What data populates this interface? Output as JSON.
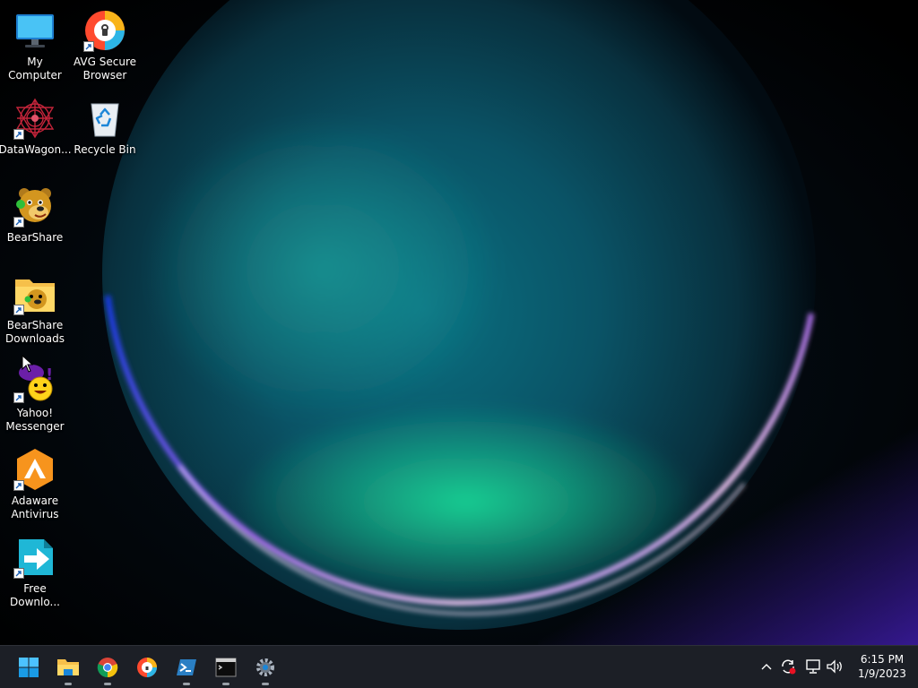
{
  "desktop": {
    "icons": [
      {
        "name": "my-computer",
        "label": "My Computer"
      },
      {
        "name": "avg-secure-browser",
        "label": "AVG Secure\nBrowser"
      },
      {
        "name": "datawagon",
        "label": "DataWagon..."
      },
      {
        "name": "recycle-bin",
        "label": "Recycle Bin"
      },
      {
        "name": "bearshare",
        "label": "BearShare"
      },
      {
        "name": "bearshare-downloads",
        "label": "BearShare\nDownloads"
      },
      {
        "name": "yahoo-messenger",
        "label": "Yahoo!\nMessenger"
      },
      {
        "name": "adaware-antivirus",
        "label": "Adaware\nAntivirus"
      },
      {
        "name": "free-download",
        "label": "Free\nDownlo..."
      }
    ]
  },
  "taskbar": {
    "apps": [
      {
        "name": "start-button",
        "icon": "windows-logo-icon"
      },
      {
        "name": "file-explorer",
        "icon": "folder-icon"
      },
      {
        "name": "chrome",
        "icon": "chrome-icon"
      },
      {
        "name": "avg-browser",
        "icon": "avg-browser-icon"
      },
      {
        "name": "powershell",
        "icon": "powershell-icon"
      },
      {
        "name": "command-prompt",
        "icon": "terminal-icon"
      },
      {
        "name": "settings",
        "icon": "gear-icon"
      }
    ],
    "tray": {
      "icons": [
        "chevron-up-icon",
        "sync-icon",
        "network-icon",
        "volume-icon"
      ]
    },
    "clock": {
      "time": "6:15 PM",
      "date": "1/9/2023"
    }
  },
  "colors": {
    "taskbar": "#1c1f26",
    "accent": "#00a2ed"
  }
}
